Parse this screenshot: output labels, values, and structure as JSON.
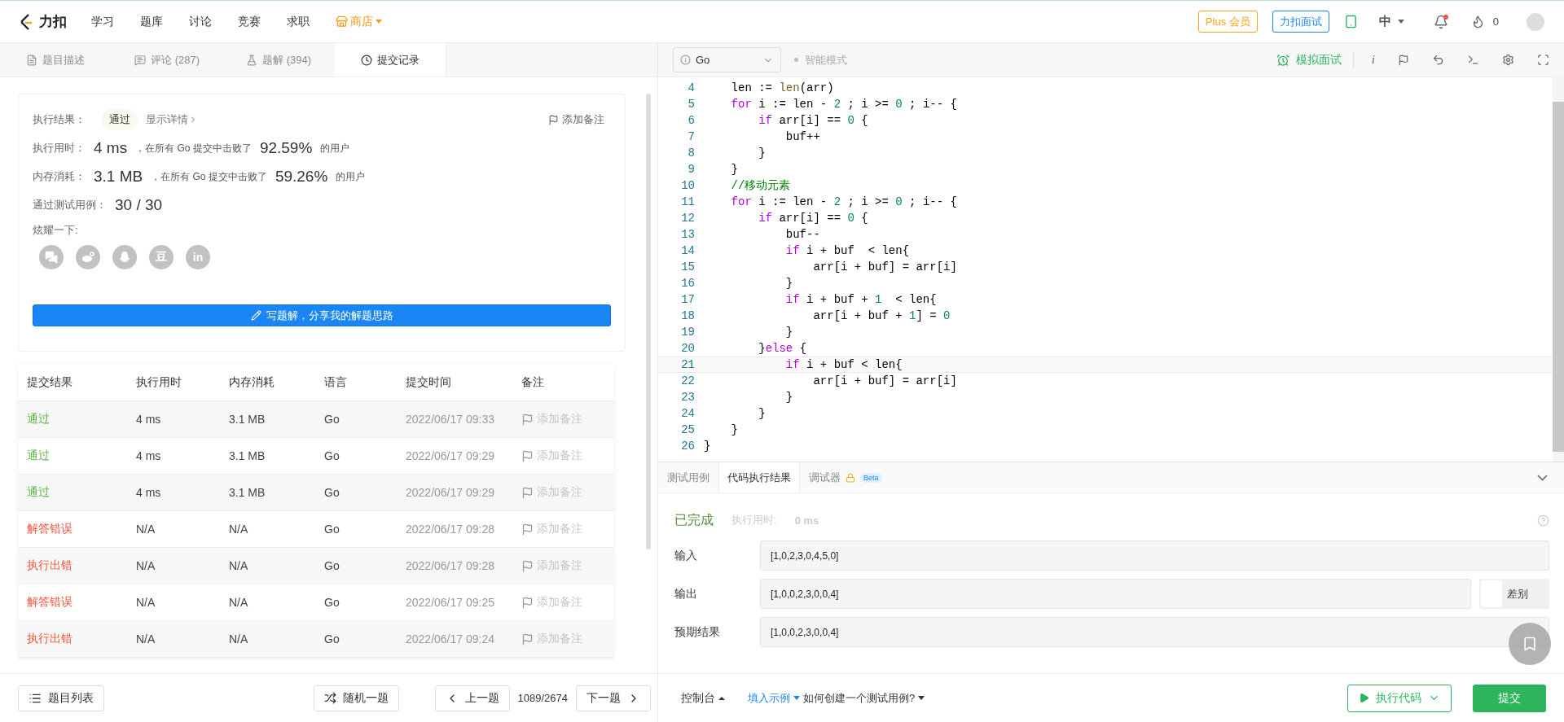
{
  "nav": {
    "logo": "力扣",
    "items": [
      {
        "label": "学习"
      },
      {
        "label": "题库"
      },
      {
        "label": "讨论"
      },
      {
        "label": "竞赛"
      },
      {
        "label": "求职"
      }
    ],
    "store": "商店",
    "plus": "Plus 会员",
    "interview": "力扣面试",
    "lang": "中",
    "notifications": {
      "unread": true
    },
    "streak": "0"
  },
  "left_tabs": [
    {
      "label": "题目描述",
      "selected": false
    },
    {
      "label": "评论 (287)",
      "selected": false
    },
    {
      "label": "题解 (394)",
      "selected": false
    },
    {
      "label": "提交记录",
      "selected": true
    }
  ],
  "summary": {
    "result_label": "执行结果：",
    "result": "通过",
    "details_link": "显示详情",
    "note": "添加备注",
    "stats": [
      {
        "label": "执行用时：",
        "value": "4 ms",
        "text": "，在所有 Go 提交中击败了",
        "percent": "92.59%",
        "suffix": "的用户"
      },
      {
        "label": "内存消耗：",
        "value": "3.1 MB",
        "text": "，在所有 Go 提交中击败了",
        "percent": "59.26%",
        "suffix": "的用户"
      }
    ],
    "tests": {
      "label": "通过测试用例：",
      "value": "30 / 30"
    },
    "share_label": "炫耀一下:",
    "share": [
      {
        "kind": "chat"
      },
      {
        "kind": "swirl"
      },
      {
        "kind": "penguin"
      },
      {
        "kind": "text",
        "text": "豆"
      },
      {
        "kind": "text",
        "text": "in"
      }
    ],
    "write_button": "写题解，分享我的解题思路"
  },
  "table": {
    "columns": [
      "提交结果",
      "执行用时",
      "内存消耗",
      "语言",
      "提交时间",
      "备注"
    ],
    "rows": [
      {
        "result": "通过",
        "kind": "accepted",
        "time": "4 ms",
        "memory": "3.1 MB",
        "language": "Go",
        "submitted": "2022/06/17 09:33",
        "note": "添加备注"
      },
      {
        "result": "通过",
        "kind": "accepted",
        "time": "4 ms",
        "memory": "3.1 MB",
        "language": "Go",
        "submitted": "2022/06/17 09:29",
        "note": "添加备注"
      },
      {
        "result": "通过",
        "kind": "accepted",
        "time": "4 ms",
        "memory": "3.1 MB",
        "language": "Go",
        "submitted": "2022/06/17 09:29",
        "note": "添加备注"
      },
      {
        "result": "解答错误",
        "kind": "error",
        "time": "N/A",
        "memory": "N/A",
        "language": "Go",
        "submitted": "2022/06/17 09:28",
        "note": "添加备注"
      },
      {
        "result": "执行出错",
        "kind": "error",
        "time": "N/A",
        "memory": "N/A",
        "language": "Go",
        "submitted": "2022/06/17 09:28",
        "note": "添加备注"
      },
      {
        "result": "解答错误",
        "kind": "error",
        "time": "N/A",
        "memory": "N/A",
        "language": "Go",
        "submitted": "2022/06/17 09:25",
        "note": "添加备注"
      },
      {
        "result": "执行出错",
        "kind": "error",
        "time": "N/A",
        "memory": "N/A",
        "language": "Go",
        "submitted": "2022/06/17 09:24",
        "note": "添加备注"
      }
    ]
  },
  "left_footer": {
    "list": "题目列表",
    "random": "随机一题",
    "prev": "上一题",
    "counter": "1089/2674",
    "next": "下一题"
  },
  "editor": {
    "language": "Go",
    "mode": "智能模式",
    "mock": "模拟面试",
    "info_glyph": "i",
    "lines": [
      {
        "number": "4",
        "current": false,
        "tokens": [
          {
            "kind": "plain",
            "text": "    len := "
          },
          {
            "kind": "builtin",
            "text": "len"
          },
          {
            "kind": "plain",
            "text": "(arr)"
          }
        ]
      },
      {
        "number": "5",
        "current": false,
        "tokens": [
          {
            "kind": "keyword",
            "text": "    for"
          },
          {
            "kind": "plain",
            "text": " i := len - "
          },
          {
            "kind": "number",
            "text": "2"
          },
          {
            "kind": "plain",
            "text": " ; i >= "
          },
          {
            "kind": "number",
            "text": "0"
          },
          {
            "kind": "plain",
            "text": " ; i-- {"
          }
        ]
      },
      {
        "number": "6",
        "current": false,
        "tokens": [
          {
            "kind": "keyword",
            "text": "        if"
          },
          {
            "kind": "plain",
            "text": " arr[i] == "
          },
          {
            "kind": "number",
            "text": "0"
          },
          {
            "kind": "plain",
            "text": " {"
          }
        ]
      },
      {
        "number": "7",
        "current": false,
        "tokens": [
          {
            "kind": "plain",
            "text": "            buf++"
          }
        ]
      },
      {
        "number": "8",
        "current": false,
        "tokens": [
          {
            "kind": "plain",
            "text": "        }"
          }
        ]
      },
      {
        "number": "9",
        "current": false,
        "tokens": [
          {
            "kind": "plain",
            "text": "    }"
          }
        ]
      },
      {
        "number": "10",
        "current": false,
        "tokens": [
          {
            "kind": "comment",
            "text": "    //移动元素"
          }
        ]
      },
      {
        "number": "11",
        "current": false,
        "tokens": [
          {
            "kind": "keyword",
            "text": "    for"
          },
          {
            "kind": "plain",
            "text": " i := len - "
          },
          {
            "kind": "number",
            "text": "2"
          },
          {
            "kind": "plain",
            "text": " ; i >= "
          },
          {
            "kind": "number",
            "text": "0"
          },
          {
            "kind": "plain",
            "text": " ; i-- {"
          }
        ]
      },
      {
        "number": "12",
        "current": false,
        "tokens": [
          {
            "kind": "keyword",
            "text": "        if"
          },
          {
            "kind": "plain",
            "text": " arr[i] == "
          },
          {
            "kind": "number",
            "text": "0"
          },
          {
            "kind": "plain",
            "text": " {"
          }
        ]
      },
      {
        "number": "13",
        "current": false,
        "tokens": [
          {
            "kind": "plain",
            "text": "            buf--"
          }
        ]
      },
      {
        "number": "14",
        "current": false,
        "tokens": [
          {
            "kind": "keyword",
            "text": "            if"
          },
          {
            "kind": "plain",
            "text": " i + buf  < len{"
          }
        ]
      },
      {
        "number": "15",
        "current": false,
        "tokens": [
          {
            "kind": "plain",
            "text": "                arr[i + buf] = arr[i]"
          }
        ]
      },
      {
        "number": "16",
        "current": false,
        "tokens": [
          {
            "kind": "plain",
            "text": "            }"
          }
        ]
      },
      {
        "number": "17",
        "current": false,
        "tokens": [
          {
            "kind": "keyword",
            "text": "            if"
          },
          {
            "kind": "plain",
            "text": " i + buf + "
          },
          {
            "kind": "number",
            "text": "1"
          },
          {
            "kind": "plain",
            "text": "  < len{"
          }
        ]
      },
      {
        "number": "18",
        "current": false,
        "tokens": [
          {
            "kind": "plain",
            "text": "                arr[i + buf + "
          },
          {
            "kind": "number",
            "text": "1"
          },
          {
            "kind": "plain",
            "text": "] = "
          },
          {
            "kind": "number",
            "text": "0"
          }
        ]
      },
      {
        "number": "19",
        "current": false,
        "tokens": [
          {
            "kind": "plain",
            "text": "            }"
          }
        ]
      },
      {
        "number": "20",
        "current": false,
        "tokens": [
          {
            "kind": "plain",
            "text": "        }"
          },
          {
            "kind": "keyword",
            "text": "else"
          },
          {
            "kind": "plain",
            "text": " {"
          }
        ]
      },
      {
        "number": "21",
        "current": true,
        "tokens": [
          {
            "kind": "keyword",
            "text": "            if"
          },
          {
            "kind": "plain",
            "text": " i + buf < len{"
          }
        ]
      },
      {
        "number": "22",
        "current": false,
        "tokens": [
          {
            "kind": "plain",
            "text": "                arr[i + buf] = arr[i]"
          }
        ]
      },
      {
        "number": "23",
        "current": false,
        "tokens": [
          {
            "kind": "plain",
            "text": "            }"
          }
        ]
      },
      {
        "number": "24",
        "current": false,
        "tokens": [
          {
            "kind": "plain",
            "text": "        }"
          }
        ]
      },
      {
        "number": "25",
        "current": false,
        "tokens": [
          {
            "kind": "plain",
            "text": "    }"
          }
        ]
      },
      {
        "number": "26",
        "current": false,
        "tokens": [
          {
            "kind": "plain",
            "text": "}"
          }
        ]
      }
    ]
  },
  "console_tabs": [
    {
      "label": "测试用例",
      "locked": false,
      "selected": false
    },
    {
      "label": "代码执行结果",
      "locked": false,
      "selected": true
    },
    {
      "label": "调试器",
      "locked": true,
      "badge": "Beta",
      "selected": false
    }
  ],
  "result": {
    "status": "已完成",
    "runtime_label": "执行用时:",
    "runtime": "0 ms",
    "fields": [
      {
        "label": "输入",
        "value": "[1,0,2,3,0,4,5,0]"
      },
      {
        "label": "输出",
        "value": "[1,0,0,2,3,0,0,4]",
        "diff": {
          "label": "差别",
          "on": false
        }
      },
      {
        "label": "预期结果",
        "value": "[1,0,0,2,3,0,0,4]"
      }
    ]
  },
  "right_footer": {
    "console": "控制台",
    "example": "填入示例",
    "howto": "如何创建一个测试用例?",
    "run": "执行代码",
    "submit": "提交"
  }
}
